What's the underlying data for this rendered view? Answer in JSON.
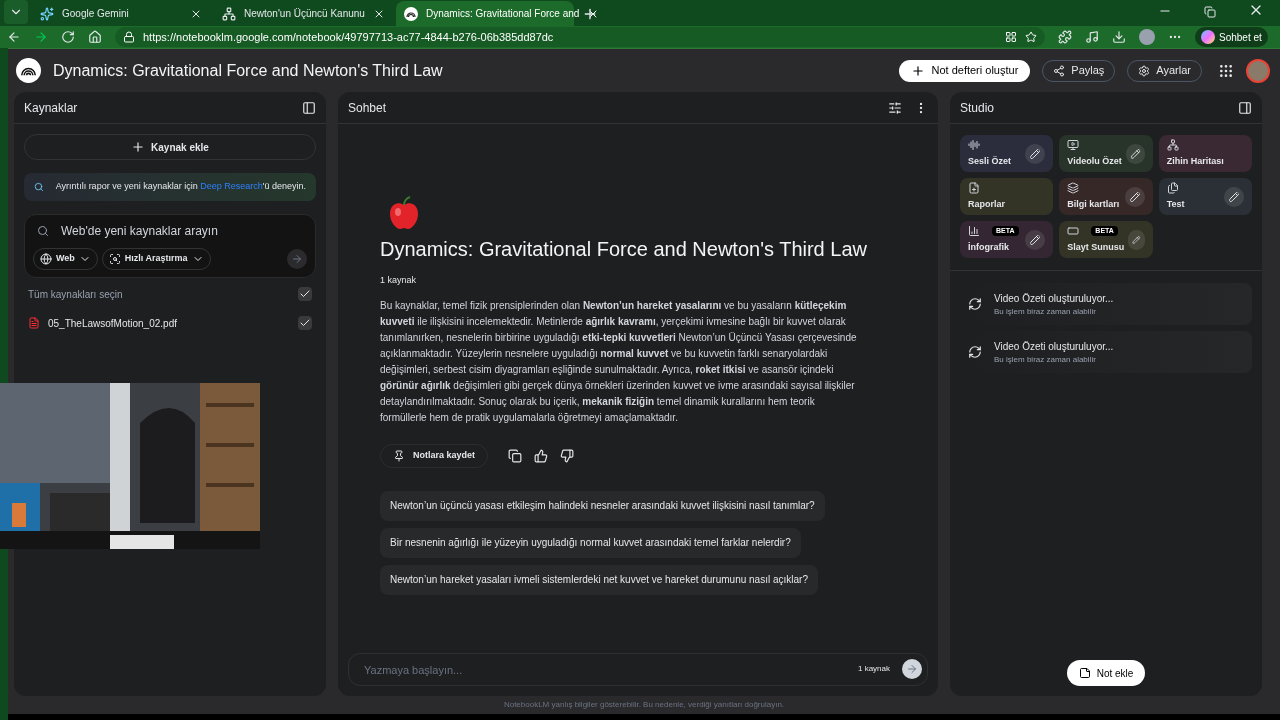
{
  "browser": {
    "tabs": [
      {
        "title": "Google Gemini",
        "selected": false
      },
      {
        "title": "Newton'un Üçüncü Kanunu",
        "selected": false
      },
      {
        "title": "Dynamics: Gravitational Force and",
        "selected": true
      }
    ],
    "url": "https://notebooklm.google.com/notebook/49797713-ac77-4844-b276-06b385dd87dc",
    "copilot": "Sohbet et"
  },
  "header": {
    "title": "Dynamics: Gravitational Force and Newton's Third Law",
    "create": "Not defteri oluştur",
    "share": "Paylaş",
    "settings": "Ayarlar"
  },
  "sources": {
    "title": "Kaynaklar",
    "add": "Kaynak ekle",
    "banner": {
      "before": "Ayrıntılı rapor ve yeni kaynaklar için ",
      "link": "Deep Research",
      "after": "'ü deneyin."
    },
    "search": {
      "placeholder": "Web'de yeni kaynaklar arayın",
      "chips": [
        "Web",
        "Hızlı Araştırma"
      ]
    },
    "select_all": {
      "label": "Tüm kaynakları seçin",
      "checked": true
    },
    "items": [
      {
        "name": "05_TheLawsofMotion_02.pdf",
        "checked": true
      }
    ]
  },
  "chat": {
    "title": "Sohbet",
    "notebook_title": "Dynamics: Gravitational Force and Newton's Third Law",
    "source_count": "1 kaynak",
    "summary": "Bu kaynaklar, temel fizik prensiplerinden olan **Newton’un hareket yasalarını** ve bu yasaların **kütleçekim kuvveti** ile ilişkisini incelemektedir. Metinlerde **ağırlık kavramı**, yerçekimi ivmesine bağlı bir kuvvet olarak tanımlanırken, nesnelerin birbirine uyguladığı **etki-tepki kuvvetleri** Newton’un Üçüncü Yasası çerçevesinde açıklanmaktadır. Yüzeylerin nesnelere uyguladığı **normal kuvvet** ve bu kuvvetin farklı senaryolardaki değişimleri, serbest cisim diyagramları eşliğinde sunulmaktadır. Ayrıca, **roket itkisi** ve asansör içindeki **görünür ağırlık** değişimleri gibi gerçek dünya örnekleri üzerinden kuvvet ve ivme arasındaki sayısal ilişkiler detaylandırılmaktadır. Sonuç olarak bu içerik, **mekanik fiziğin** temel dinamik kurallarını hem teorik formüllerle hem de pratik uygulamalarla öğretmeyi amaçlamaktadır.",
    "save_note": "Notlara kaydet",
    "suggestions": [
      "Newton’un üçüncü yasası etkileşim halindeki nesneler arasındaki kuvvet ilişkisini nasıl tanımlar?",
      "Bir nesnenin ağırlığı ile yüzeyin uyguladığı normal kuvvet arasındaki temel farklar nelerdir?",
      "Newton’un hareket yasaları ivmeli sistemlerdeki net kuvvet ve hareket durumunu nasıl açıklar?"
    ],
    "input": {
      "placeholder": "Yazmaya başlayın...",
      "source_count": "1 kaynak"
    }
  },
  "studio": {
    "title": "Studio",
    "tiles": [
      {
        "label": "Sesli Özet",
        "color": "#2b2d3c",
        "editable": true
      },
      {
        "label": "Videolu Özet",
        "color": "#283329",
        "editable": true
      },
      {
        "label": "Zihin Haritası",
        "color": "#3a2832",
        "editable": false
      },
      {
        "label": "Raporlar",
        "color": "#333326",
        "editable": false
      },
      {
        "label": "Bilgi kartları",
        "color": "#372828",
        "editable": true
      },
      {
        "label": "Test",
        "color": "#2a3035",
        "editable": true
      },
      {
        "label": "İnfografik",
        "color": "#342733",
        "editable": true,
        "beta_label": "BETA"
      },
      {
        "label": "Slayt Sunusu",
        "color": "#333326",
        "editable": true,
        "beta_label": "BETA"
      }
    ],
    "jobs": [
      {
        "title": "Video Özeti oluşturuluyor...",
        "subtitle": "Bu işlem biraz zaman alabilir"
      },
      {
        "title": "Video Özeti oluşturuluyor...",
        "subtitle": "Bu işlem biraz zaman alabilir"
      }
    ],
    "add_note": "Not ekle"
  },
  "footer": "NotebookLM yanlış bilgiler gösterebilir. Bu nedenle, verdiği yanıtları doğrulayın."
}
